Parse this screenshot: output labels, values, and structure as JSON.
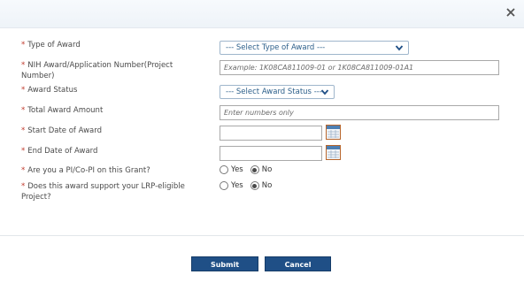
{
  "dialog": {
    "close_label": "×"
  },
  "form": {
    "type_of_award": {
      "label": "Type of Award",
      "selected": "--- Select Type of Award ---"
    },
    "nih_award_number": {
      "label": "NIH Award/Application Number(Project Number)",
      "placeholder": "Example: 1K08CA811009-01 or 1K08CA811009-01A1"
    },
    "award_status": {
      "label": "Award Status",
      "selected": "--- Select Award Status ---"
    },
    "total_award_amount": {
      "label": "Total Award Amount",
      "placeholder": "Enter numbers only"
    },
    "start_date": {
      "label": "Start Date of Award"
    },
    "end_date": {
      "label": "End Date of Award"
    },
    "pi_question": {
      "label": "Are you a PI/Co-PI on this Grant?",
      "options": [
        "Yes",
        "No"
      ],
      "selected": "No"
    },
    "lrp_question": {
      "label": "Does this award support your LRP-eligible Project?",
      "options": [
        "Yes",
        "No"
      ],
      "selected": "No"
    },
    "required_marker": "*"
  },
  "buttons": {
    "submit": "Submit",
    "cancel": "Cancel"
  },
  "colors": {
    "button_bg": "#1f4f86",
    "required": "#c0392b",
    "select_text": "#2c5f8a"
  },
  "icons": {
    "close": "close-icon",
    "dropdown": "chevron-down-icon",
    "calendar": "calendar-icon"
  }
}
